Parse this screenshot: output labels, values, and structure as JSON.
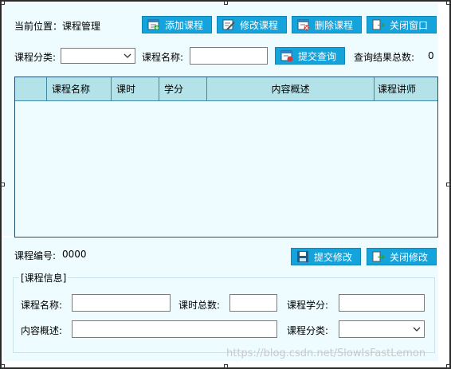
{
  "location": {
    "label": "当前位置：",
    "value": "课程管理"
  },
  "toolbar": {
    "add_label": "添加课程",
    "edit_label": "修改课程",
    "delete_label": "删除课程",
    "close_label": "关闭窗口"
  },
  "search": {
    "category_label": "课程分类:",
    "category_value": "",
    "name_label": "课程名称:",
    "name_value": "",
    "submit_label": "提交查询",
    "result_label": "查询结果总数:",
    "result_count": "0"
  },
  "grid": {
    "columns": [
      "",
      "课程名称",
      "课时",
      "学分",
      "内容概述",
      "课程讲师"
    ]
  },
  "detail": {
    "id_label": "课程编号:",
    "id_value": "0000",
    "save_label": "提交修改",
    "close_label": "关闭修改",
    "group_title": "[课程信息]",
    "name_label": "课程名称:",
    "name_value": "",
    "hours_label": "课时总数:",
    "hours_value": "",
    "credit_label": "课程学分:",
    "credit_value": "",
    "summary_label": "内容概述:",
    "summary_value": "",
    "category_label": "课程分类:",
    "category_value": ""
  },
  "watermark": "https://blog.csdn.net/SlowIsFastLemon",
  "colors": {
    "button": "#15a3dc",
    "panel": "#eefcff",
    "header": "#b3e2e9"
  }
}
